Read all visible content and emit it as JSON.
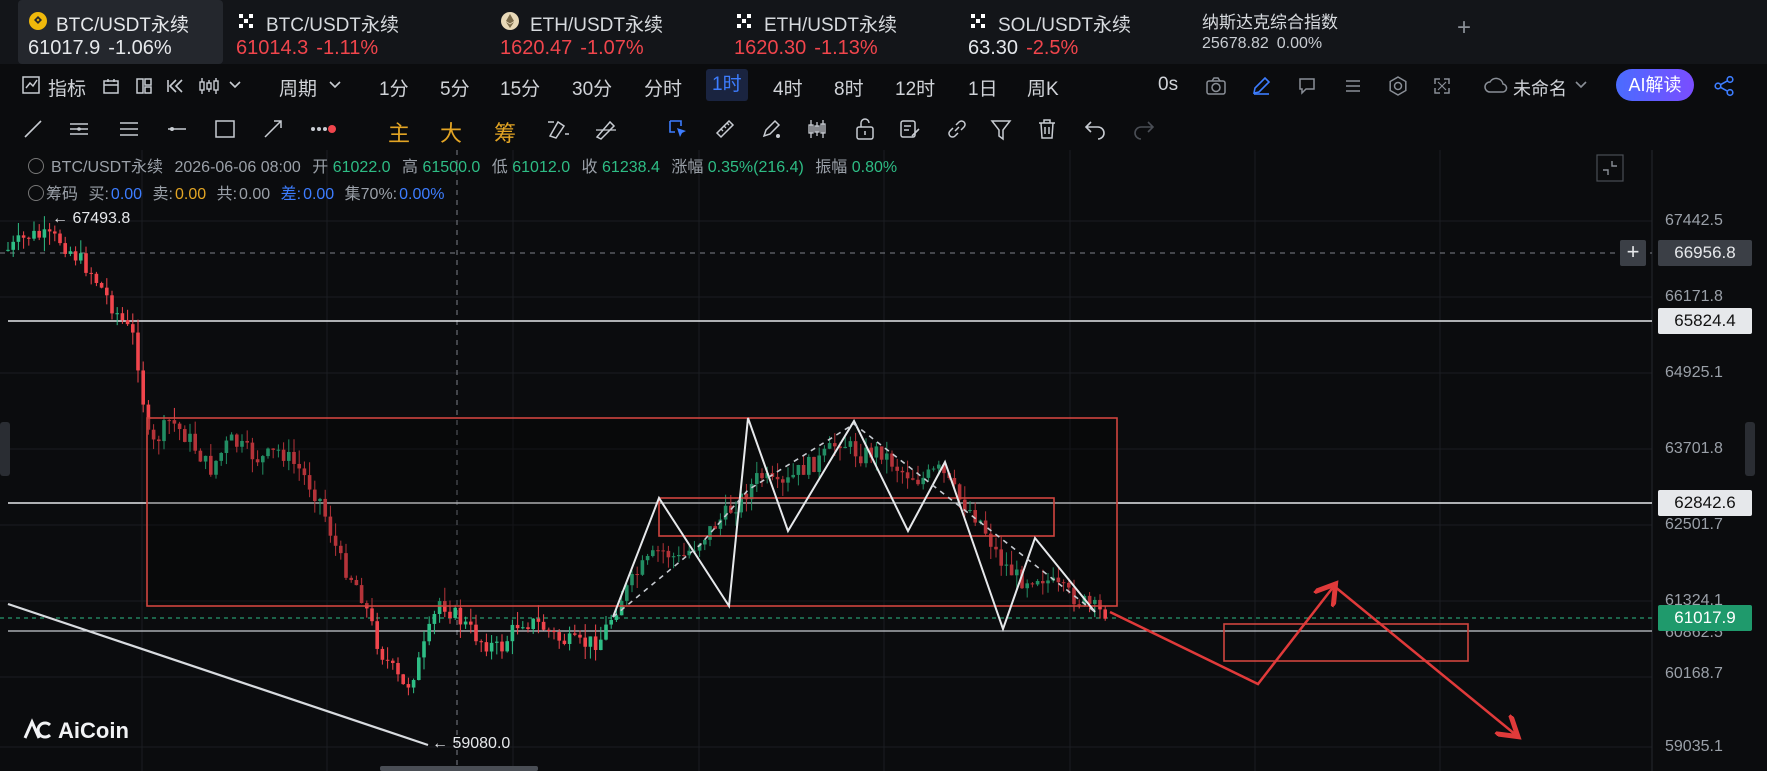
{
  "tickers": [
    {
      "name": "BTC/USDT永续",
      "price": "61017.9",
      "change": "-1.06%",
      "icon": "btc-coin-icon"
    },
    {
      "name": "BTC/USDT永续",
      "price": "61014.3",
      "change": "-1.11%",
      "icon": "okx-icon"
    },
    {
      "name": "ETH/USDT永续",
      "price": "1620.47",
      "change": "-1.07%",
      "icon": "eth-coin-icon"
    },
    {
      "name": "ETH/USDT永续",
      "price": "1620.30",
      "change": "-1.13%",
      "icon": "okx-icon"
    },
    {
      "name": "SOL/USDT永续",
      "price": "63.30",
      "change": "-2.5%",
      "icon": "okx-icon"
    },
    {
      "name": "纳斯达克综合指数",
      "price": "25678.82",
      "change": "0.00%"
    }
  ],
  "add_tab": "+",
  "toolbar": {
    "indicators": "指标",
    "period": "周期",
    "intervals": [
      "1分",
      "5分",
      "15分",
      "30分",
      "分时",
      "1时",
      "4时",
      "8时",
      "12时",
      "1日",
      "周K"
    ],
    "selected_interval": "1时",
    "countdown": "0s",
    "layout_name": "未命名",
    "ai_label": "AI解读"
  },
  "drawbar": {
    "main": "主",
    "big": "大",
    "chip": "筹"
  },
  "chart_info": {
    "symbol": "BTC/USDT永续",
    "datetime": "2026-06-06 08:00",
    "open_label": "开",
    "open": "61022.0",
    "high_label": "高",
    "high": "61500.0",
    "low_label": "低",
    "low": "61012.0",
    "close_label": "收",
    "close": "61238.4",
    "change_label": "涨幅",
    "change": "0.35%(216.4)",
    "amp_label": "振幅",
    "amp": "0.80%"
  },
  "chip_info": {
    "label": "筹码",
    "buy_label": "买:",
    "buy": "0.00",
    "sell_label": "卖:",
    "sell": "0.00",
    "total_label": "共:",
    "total": "0.00",
    "diff_label": "差:",
    "diff": "0.00",
    "conc_label": "集70%:",
    "conc": "0.00%"
  },
  "price_axis": {
    "ticks": [
      "67442.5",
      "66171.8",
      "64925.1",
      "63701.8",
      "62501.7",
      "61324.1",
      "60862.5",
      "60168.7",
      "59035.1"
    ],
    "crosshair": "66956.8",
    "line1": "65824.4",
    "line2": "62842.6",
    "last": "61017.9"
  },
  "markers": {
    "high": "← 67493.8",
    "low": "← 59080.0"
  },
  "logo": "AiCoin",
  "colors": {
    "up": "#2ebd85",
    "down": "#f0454c",
    "accent": "#3d7dff",
    "annotation": "#e03a3a"
  },
  "chart_data": {
    "type": "candlestick",
    "symbol": "BTC/USDT永续",
    "interval": "1时",
    "ylim": [
      58900,
      68300
    ],
    "horizontal_lines": [
      65824.4,
      62842.6,
      61017.9,
      60862.5
    ],
    "path_white": [
      62700,
      61330,
      64300,
      62270,
      64200,
      62270,
      63590,
      62270,
      61000,
      62450,
      61200
    ],
    "forecast_red": [
      61200,
      60300,
      61480,
      60000
    ]
  }
}
